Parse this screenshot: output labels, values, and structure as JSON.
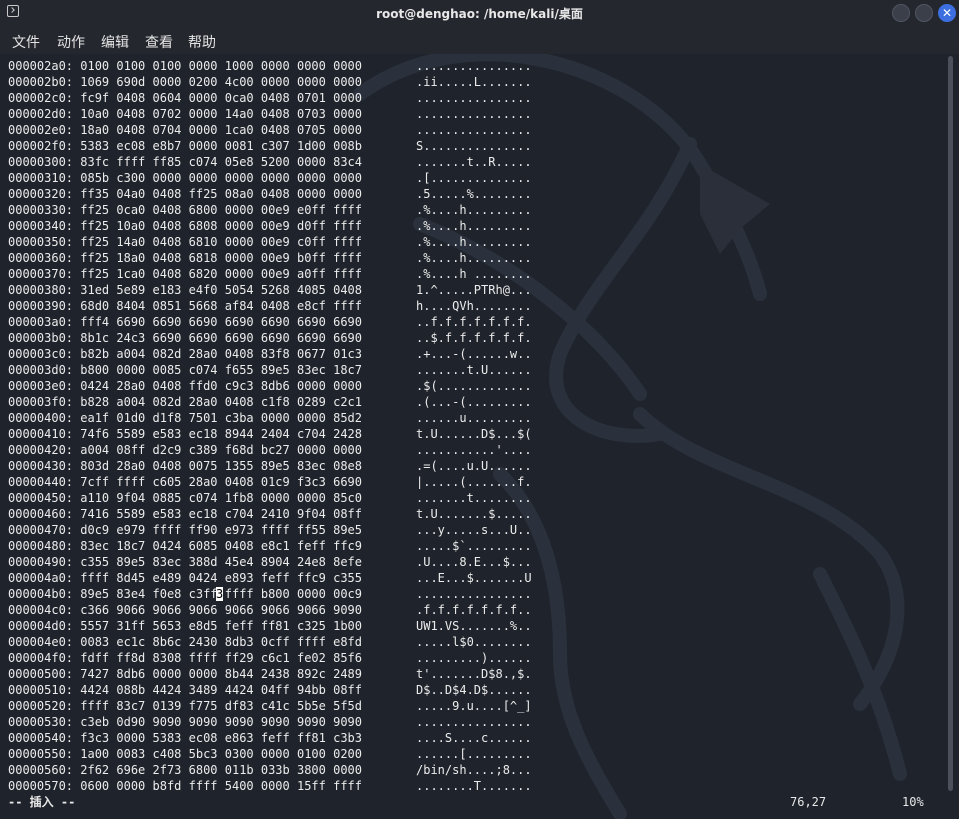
{
  "window": {
    "title": "root@denghao: /home/kali/桌面",
    "close_glyph": "✕"
  },
  "menu": [
    "文件",
    "动作",
    "编辑",
    "查看",
    "帮助"
  ],
  "hexdump": [
    {
      "hex": "000002a0: 0100 0100 0100 0000 1000 0000 0000 0000",
      "ascii": "................"
    },
    {
      "hex": "000002b0: 1069 690d 0000 0200 4c00 0000 0000 0000",
      "ascii": ".ii.....L......."
    },
    {
      "hex": "000002c0: fc9f 0408 0604 0000 0ca0 0408 0701 0000",
      "ascii": "................"
    },
    {
      "hex": "000002d0: 10a0 0408 0702 0000 14a0 0408 0703 0000",
      "ascii": "................"
    },
    {
      "hex": "000002e0: 18a0 0408 0704 0000 1ca0 0408 0705 0000",
      "ascii": "................"
    },
    {
      "hex": "000002f0: 5383 ec08 e8b7 0000 0081 c307 1d00 008b",
      "ascii": "S..............."
    },
    {
      "hex": "00000300: 83fc ffff ff85 c074 05e8 5200 0000 83c4",
      "ascii": ".......t..R....."
    },
    {
      "hex": "00000310: 085b c300 0000 0000 0000 0000 0000 0000",
      "ascii": ".[.............."
    },
    {
      "hex": "00000320: ff35 04a0 0408 ff25 08a0 0408 0000 0000",
      "ascii": ".5.....%........"
    },
    {
      "hex": "00000330: ff25 0ca0 0408 6800 0000 00e9 e0ff ffff",
      "ascii": ".%....h........."
    },
    {
      "hex": "00000340: ff25 10a0 0408 6808 0000 00e9 d0ff ffff",
      "ascii": ".%....h........."
    },
    {
      "hex": "00000350: ff25 14a0 0408 6810 0000 00e9 c0ff ffff",
      "ascii": ".%....h........."
    },
    {
      "hex": "00000360: ff25 18a0 0408 6818 0000 00e9 b0ff ffff",
      "ascii": ".%....h........."
    },
    {
      "hex": "00000370: ff25 1ca0 0408 6820 0000 00e9 a0ff ffff",
      "ascii": ".%....h ........"
    },
    {
      "hex": "00000380: 31ed 5e89 e183 e4f0 5054 5268 4085 0408",
      "ascii": "1.^.....PTRh@..."
    },
    {
      "hex": "00000390: 68d0 8404 0851 5668 af84 0408 e8cf ffff",
      "ascii": "h....QVh........"
    },
    {
      "hex": "000003a0: fff4 6690 6690 6690 6690 6690 6690 6690",
      "ascii": "..f.f.f.f.f.f.f."
    },
    {
      "hex": "000003b0: 8b1c 24c3 6690 6690 6690 6690 6690 6690",
      "ascii": "..$.f.f.f.f.f.f."
    },
    {
      "hex": "000003c0: b82b a004 082d 28a0 0408 83f8 0677 01c3",
      "ascii": ".+...-(......w.."
    },
    {
      "hex": "000003d0: b800 0000 0085 c074 f655 89e5 83ec 18c7",
      "ascii": ".......t.U......"
    },
    {
      "hex": "000003e0: 0424 28a0 0408 ffd0 c9c3 8db6 0000 0000",
      "ascii": ".$(............."
    },
    {
      "hex": "000003f0: b828 a004 082d 28a0 0408 c1f8 0289 c2c1",
      "ascii": ".(...-(........."
    },
    {
      "hex": "00000400: ea1f 01d0 d1f8 7501 c3ba 0000 0000 85d2",
      "ascii": "......u........."
    },
    {
      "hex": "00000410: 74f6 5589 e583 ec18 8944 2404 c704 2428",
      "ascii": "t.U......D$...$("
    },
    {
      "hex": "00000420: a004 08ff d2c9 c389 f68d bc27 0000 0000",
      "ascii": "...........'...."
    },
    {
      "hex": "00000430: 803d 28a0 0408 0075 1355 89e5 83ec 08e8",
      "ascii": ".=(....u.U......"
    },
    {
      "hex": "00000440: 7cff ffff c605 28a0 0408 01c9 f3c3 6690",
      "ascii": "|.....(.......f."
    },
    {
      "hex": "00000450: a110 9f04 0885 c074 1fb8 0000 0000 85c0",
      "ascii": ".......t........"
    },
    {
      "hex": "00000460: 7416 5589 e583 ec18 c704 2410 9f04 08ff",
      "ascii": "t.U.......$....."
    },
    {
      "hex": "00000470: d0c9 e979 ffff ff90 e973 ffff ff55 89e5",
      "ascii": "...y.....s...U.."
    },
    {
      "hex": "00000480: 83ec 18c7 0424 6085 0408 e8c1 feff ffc9",
      "ascii": ".....$`........."
    },
    {
      "hex": "00000490: c355 89e5 83ec 388d 45e4 8904 24e8 8efe",
      "ascii": ".U....8.E...$..."
    },
    {
      "hex": "000004a0: ffff 8d45 e489 0424 e893 feff ffc9 c355",
      "ascii": "...E...$.......U"
    },
    {
      "hex": "000004b0: 89e5 83e4 f0e8 c3ff ffff b800 0000 00c9",
      "ascii": "................"
    },
    {
      "hex": "000004c0: c366 9066 9066 9066 9066 9066 9066 9090",
      "ascii": ".f.f.f.f.f.f.f.."
    },
    {
      "hex": "000004d0: 5557 31ff 5653 e8d5 feff ff81 c325 1b00",
      "ascii": "UW1.VS.......%.."
    },
    {
      "hex": "000004e0: 0083 ec1c 8b6c 2430 8db3 0cff ffff e8fd",
      "ascii": ".....l$0........"
    },
    {
      "hex": "000004f0: fdff ff8d 8308 ffff ff29 c6c1 fe02 85f6",
      "ascii": ".........)......"
    },
    {
      "hex": "00000500: 7427 8db6 0000 0000 8b44 2438 892c 2489",
      "ascii": "t'.......D$8.,$."
    },
    {
      "hex": "00000510: 4424 088b 4424 3489 4424 04ff 94bb 08ff",
      "ascii": "D$..D$4.D$......"
    },
    {
      "hex": "00000520: ffff 83c7 0139 f775 df83 c41c 5b5e 5f5d",
      "ascii": ".....9.u....[^_]"
    },
    {
      "hex": "00000530: c3eb 0d90 9090 9090 9090 9090 9090 9090",
      "ascii": "................"
    },
    {
      "hex": "00000540: f3c3 0000 5383 ec08 e863 feff ff81 c3b3",
      "ascii": "....S....c......"
    },
    {
      "hex": "00000550: 1a00 0083 c408 5bc3 0300 0000 0100 0200",
      "ascii": "......[........."
    },
    {
      "hex": "00000560: 2f62 696e 2f73 6800 011b 033b 3800 0000",
      "ascii": "/bin/sh....;8..."
    },
    {
      "hex": "00000570: 0600 0000 b8fd ffff 5400 0000 15ff ffff",
      "ascii": "........T......."
    }
  ],
  "cursor": {
    "row": 33,
    "char": "3"
  },
  "status": {
    "mode": "-- 插入 --",
    "position": "76,27",
    "percent": "10%"
  }
}
